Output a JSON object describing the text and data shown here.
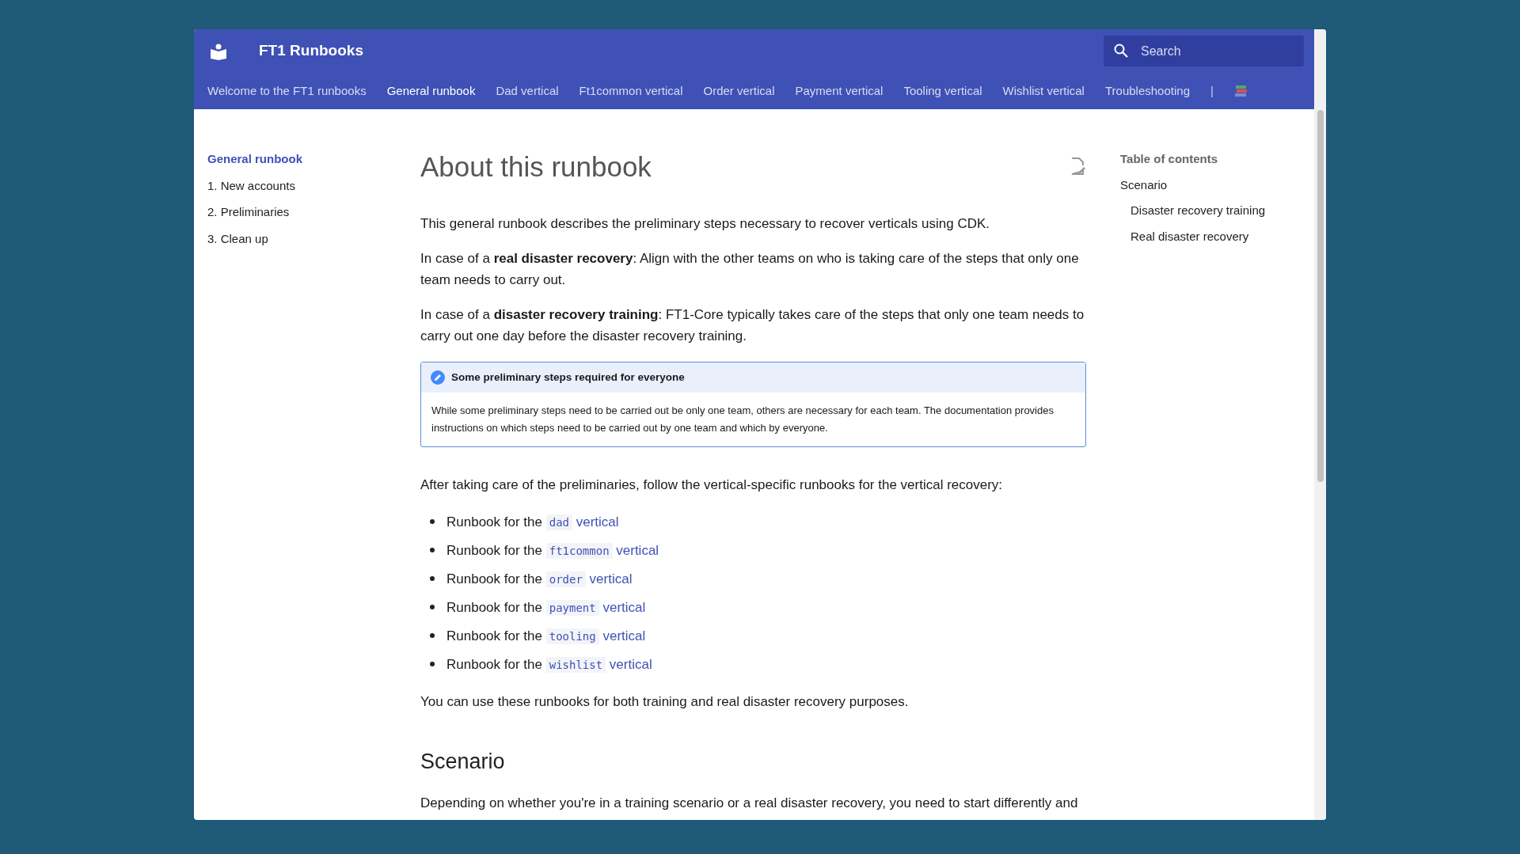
{
  "site": {
    "title": "FT1 Runbooks",
    "search": {
      "placeholder": "Search"
    }
  },
  "tabs": [
    {
      "label": "Welcome to the FT1 runbooks",
      "selected": false
    },
    {
      "label": "General runbook",
      "selected": true
    },
    {
      "label": "Dad vertical",
      "selected": false
    },
    {
      "label": "Ft1common vertical",
      "selected": false
    },
    {
      "label": "Order vertical",
      "selected": false
    },
    {
      "label": "Payment vertical",
      "selected": false
    },
    {
      "label": "Tooling vertical",
      "selected": false
    },
    {
      "label": "Wishlist vertical",
      "selected": false
    },
    {
      "label": "Troubleshooting",
      "selected": false
    }
  ],
  "tab_separator": "|",
  "sidebar": {
    "items": [
      {
        "label": "General runbook",
        "selected": true
      },
      {
        "label": "1. New accounts",
        "selected": false
      },
      {
        "label": "2. Preliminaries",
        "selected": false
      },
      {
        "label": "3. Clean up",
        "selected": false
      }
    ]
  },
  "article": {
    "title": "About this runbook",
    "blocks": [
      {
        "kind": "paragraph",
        "text": "This general runbook describes the preliminary steps necessary to recover verticals using CDK."
      },
      {
        "kind": "paragraph",
        "text": "In case of a **real disaster recovery**: Align with the other teams on who is taking care of the steps that only one team needs to carry out."
      },
      {
        "kind": "paragraph",
        "text": "In case of a **disaster recovery training**: FT1-Core typically takes care of the steps that only one team needs to carry out one day before the disaster recovery training."
      },
      {
        "kind": "admonition",
        "title": "Some preliminary steps required for everyone",
        "text": "While some preliminary steps need to be carried out be only one team, others are necessary for each team. The documentation provides instructions on which steps need to be carried out by one team and which by everyone."
      },
      {
        "kind": "paragraph",
        "text": "After taking care of the preliminaries, follow the vertical-specific runbooks for the vertical recovery:"
      },
      {
        "kind": "list",
        "items": [
          {
            "prefix": "Runbook for the",
            "code": "dad",
            "link": "vertical"
          },
          {
            "prefix": "Runbook for the",
            "code": "ft1common",
            "link": "vertical"
          },
          {
            "prefix": "Runbook for the",
            "code": "order",
            "link": "vertical"
          },
          {
            "prefix": "Runbook for the",
            "code": "payment",
            "link": "vertical"
          },
          {
            "prefix": "Runbook for the",
            "code": "tooling",
            "link": "vertical"
          },
          {
            "prefix": "Runbook for the",
            "code": "wishlist",
            "link": "vertical"
          }
        ]
      },
      {
        "kind": "paragraph",
        "text": "You can use these runbooks for both training and real disaster recovery purposes."
      },
      {
        "kind": "heading",
        "text": "Scenario"
      },
      {
        "kind": "paragraph",
        "text": "Depending on whether you're in a training scenario or a real disaster recovery, you need to start differently and"
      }
    ]
  },
  "toc": {
    "title": "Table of contents",
    "items": [
      {
        "label": "Scenario",
        "children": [
          {
            "label": "Disaster recovery training"
          },
          {
            "label": "Real disaster recovery"
          }
        ]
      }
    ]
  }
}
